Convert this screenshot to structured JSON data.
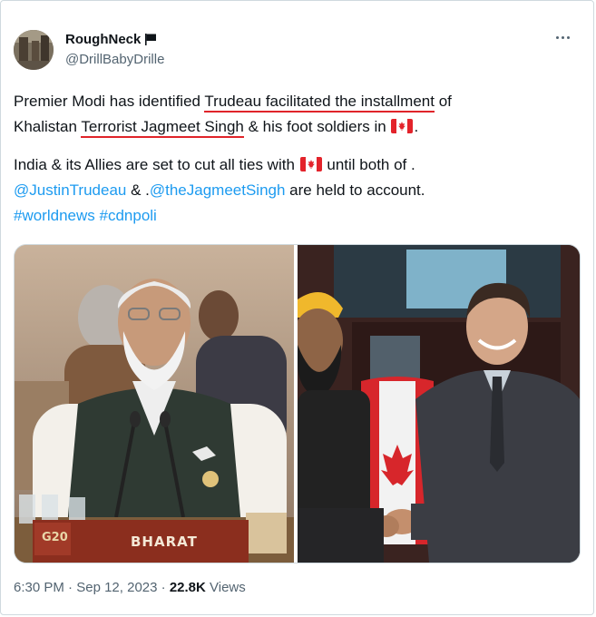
{
  "author": {
    "name": "RoughNeck",
    "handle": "@DrillBabyDrille"
  },
  "tweet": {
    "p1_l1_a": "Premier Modi has identified ",
    "p1_l1_b": "Trudeau facilitated the installment",
    "p1_l1_c": " of",
    "p1_l2_a": "Khalistan ",
    "p1_l2_b": "Terrorist Jagmeet Singh",
    "p1_l2_c": " & his foot soldiers in ",
    "p1_l2_d": ".",
    "p2_l1_a": "India & its Allies are set to cut all ties with ",
    "p2_l1_b": " until both of .",
    "mention1": "@JustinTrudeau",
    "p2_l2_mid": " & .",
    "mention2": "@theJagmeetSingh",
    "p2_l2_end": " are held to account.",
    "hashtag1": "#worldnews",
    "hashtag2": "#cdnpoli"
  },
  "media": {
    "left_photo_label": "BHARAT",
    "left_photo_badge": "G20"
  },
  "meta": {
    "time": "6:30 PM",
    "sep1": " · ",
    "date": "Sep 12, 2023",
    "sep2": " · ",
    "views_count": "22.8K",
    "views_label": " Views"
  },
  "colors": {
    "link": "#1d9bf0",
    "underline": "#e0242a",
    "secondary_text": "#536471"
  }
}
